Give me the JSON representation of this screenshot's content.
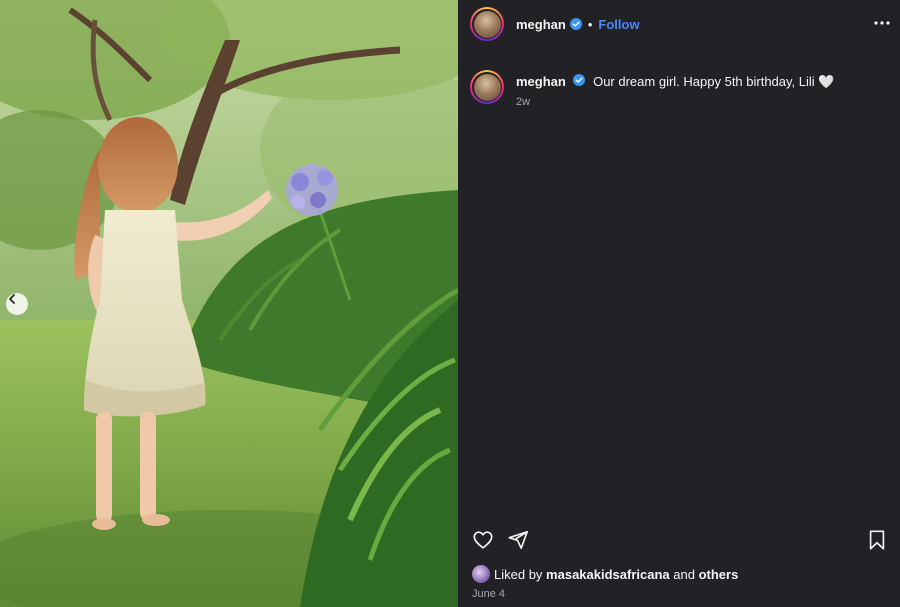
{
  "post": {
    "photo": {
      "description_icon": "photo-image"
    },
    "carousel": {
      "prev_icon": "chevron-left-icon"
    }
  },
  "header": {
    "username": "meghan",
    "separator": "•",
    "follow_label": "Follow",
    "verified_icon": "verified-badge-icon",
    "more_icon": "more-options-icon"
  },
  "caption": {
    "username": "meghan",
    "text": "Our dream girl. Happy 5th birthday, Lili 🤍",
    "time": "2w"
  },
  "actions": {
    "like_icon": "heart-icon",
    "share_icon": "send-icon",
    "save_icon": "bookmark-icon"
  },
  "likes": {
    "prefix": "Liked by",
    "liker": "masakakidsafricana",
    "connector": "and",
    "others": "others"
  },
  "date": "June 4",
  "colors": {
    "panel_bg": "#212126",
    "follow_blue": "#4a86ff",
    "verified_blue": "#3897f0",
    "muted": "#a8a8a8"
  }
}
